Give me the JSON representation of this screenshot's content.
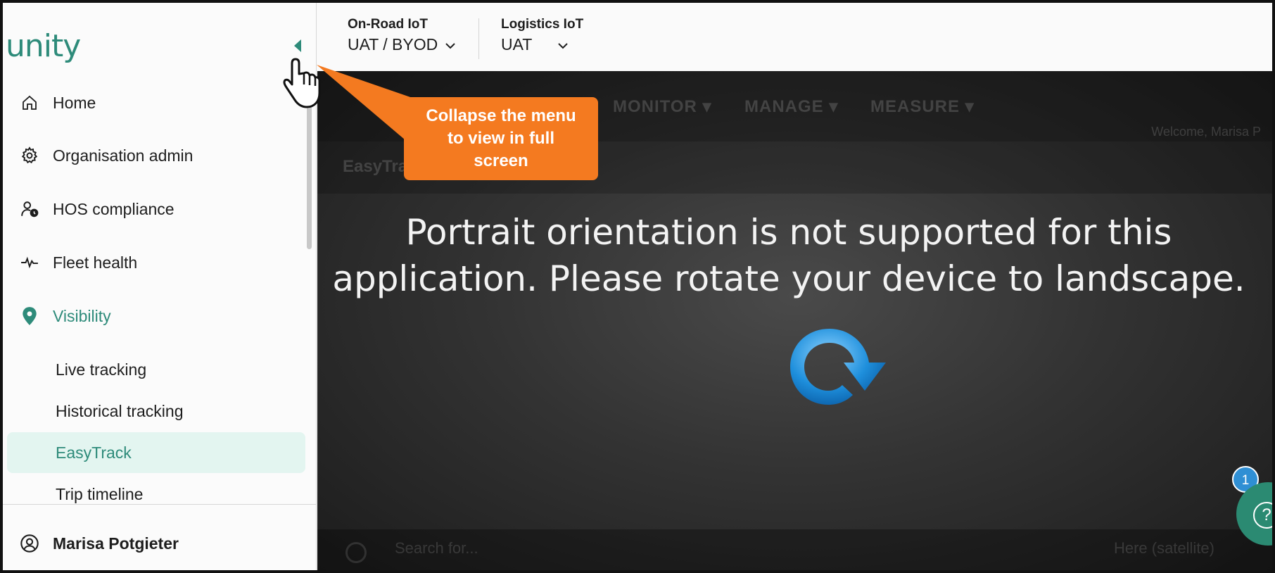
{
  "app": {
    "logo_text": "unity",
    "brand_color": "#2e8b7a",
    "accent_bg": "#e3f5f0"
  },
  "sidebar": {
    "collapse_icon": "chevron-left-icon",
    "items": [
      {
        "label": "Home",
        "icon": "home-icon"
      },
      {
        "label": "Organisation admin",
        "icon": "gear-icon"
      },
      {
        "label": "HOS compliance",
        "icon": "user-clock-icon"
      },
      {
        "label": "Fleet health",
        "icon": "pulse-icon"
      },
      {
        "label": "Visibility",
        "icon": "location-pin-icon",
        "active": true
      }
    ],
    "sub_items": [
      {
        "label": "Live tracking"
      },
      {
        "label": "Historical tracking"
      },
      {
        "label": "EasyTrack",
        "selected": true
      },
      {
        "label": "Trip timeline"
      }
    ],
    "user": {
      "name": "Marisa Potgieter",
      "icon": "user-circle-icon"
    }
  },
  "topbar": {
    "env1": {
      "title": "On-Road IoT",
      "value": "UAT / BYOD"
    },
    "env2": {
      "title": "Logistics IoT",
      "value": "UAT"
    }
  },
  "overlay": {
    "line1": "Portrait orientation is not supported for this",
    "line2": "application. Please rotate your device to landscape.",
    "rotate_icon": "rotate-arrow-icon"
  },
  "background_app": {
    "nav": [
      "MONITOR ▾",
      "MANAGE ▾",
      "MEASURE ▾"
    ],
    "welcome": "Welcome, Marisa P",
    "subtitle": "EasyTra",
    "search_placeholder": "Search for...",
    "map_type": "Here (satellite)"
  },
  "help": {
    "badge_count": "1",
    "symbol": "?"
  },
  "callout": {
    "text_line1": "Collapse the menu",
    "text_line2": "to view in full",
    "text_line3": "screen",
    "color": "#f47a20"
  }
}
